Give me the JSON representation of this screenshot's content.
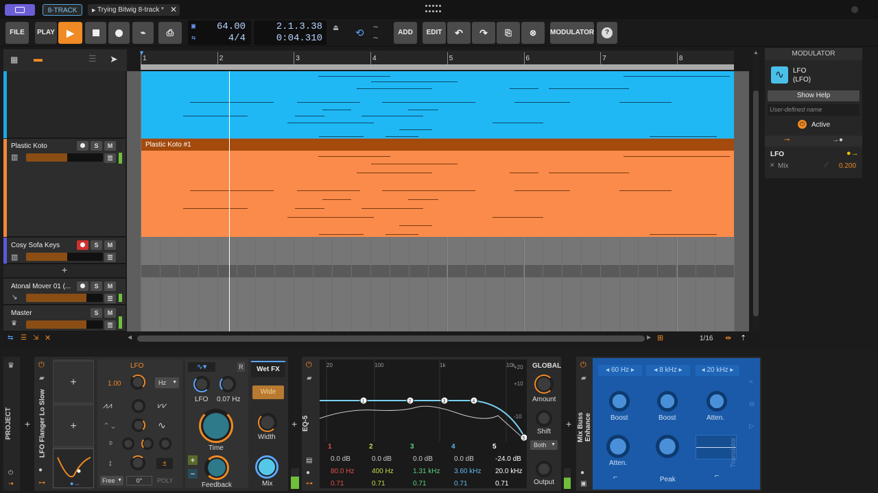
{
  "titlebar": {
    "project_tab": "8-TRACK",
    "file_tab": "Trying Bitwig 8-track *"
  },
  "transport": {
    "file": "FILE",
    "play": "PLAY",
    "tempo": "64.00",
    "time_sig": "4/4",
    "position_bars": "2.1.3.38",
    "position_time": "0:04.310",
    "add": "ADD",
    "edit": "EDIT",
    "modulator": "MODULATOR",
    "help": "?"
  },
  "arranger": {
    "ruler": [
      "1",
      "2",
      "3",
      "4",
      "5",
      "6",
      "7",
      "8"
    ],
    "tracks": [
      {
        "name": "Plastic Koto",
        "clip": "Plastic Koto #1"
      },
      {
        "name": "Cosy Sofa Keys"
      },
      {
        "name": "Atonal Mover 01 (..."
      },
      {
        "name": "Master"
      }
    ],
    "solo": "S",
    "mute": "M",
    "add_track": "+",
    "zoom": "1/16"
  },
  "inspector": {
    "header": "MODULATOR",
    "lfo_title": "LFO",
    "lfo_sub": "(LFO)",
    "show_help": "Show Help",
    "name_placeholder": "User-defined name",
    "active": "Active",
    "mod_name": "LFO",
    "mix_label": "Mix",
    "mix_value": "0.200"
  },
  "devices": {
    "project_label": "PROJECT",
    "flanger": {
      "name": "LFO Flanger Lo Slow",
      "lfo_label": "LFO",
      "rate_value": "1.00",
      "unit": "Hz",
      "lfo_knob": "LFO",
      "lfo_rate": "0.07 Hz",
      "time": "Time",
      "feedback": "Feedback",
      "wet_fx": "Wet FX",
      "wide": "Wide",
      "width": "Width",
      "mix": "Mix",
      "free": "Free",
      "phase": "0°",
      "poly": "POLY",
      "r": "R",
      "plus": "+",
      "plusminus": "±"
    },
    "eq": {
      "name": "EQ-5",
      "freq_labels": [
        "20",
        "100",
        "1k",
        "10k"
      ],
      "db_labels": [
        "+20",
        "+10",
        "-10"
      ],
      "bands": [
        {
          "n": "1",
          "gain": "0.0 dB",
          "freq": "80.0 Hz",
          "q": "0.71",
          "color": "#e0504a"
        },
        {
          "n": "2",
          "gain": "0.0 dB",
          "freq": "400 Hz",
          "q": "0.71",
          "color": "#c8d84a"
        },
        {
          "n": "3",
          "gain": "0.0 dB",
          "freq": "1.31 kHz",
          "q": "0.71",
          "color": "#5bd07a"
        },
        {
          "n": "4",
          "gain": "0.0 dB",
          "freq": "3.60 kHz",
          "q": "0.71",
          "color": "#60b8f0"
        },
        {
          "n": "5",
          "gain": "-24.0 dB",
          "freq": "20.0 kHz",
          "q": "0.71",
          "color": "#ffffff"
        }
      ],
      "global": "GLOBAL",
      "amount": "Amount",
      "shift": "Shift",
      "both": "Both",
      "output": "Output"
    },
    "mixbuss": {
      "name": "Mix Buss Enhance",
      "freqs": [
        "60 Hz",
        "8 kHz",
        "20 kHz"
      ],
      "boost1": "Boost",
      "boost2": "Boost",
      "atten1": "Atten.",
      "atten2": "Atten.",
      "peak": "Peak",
      "transistor": "Transistor"
    }
  }
}
